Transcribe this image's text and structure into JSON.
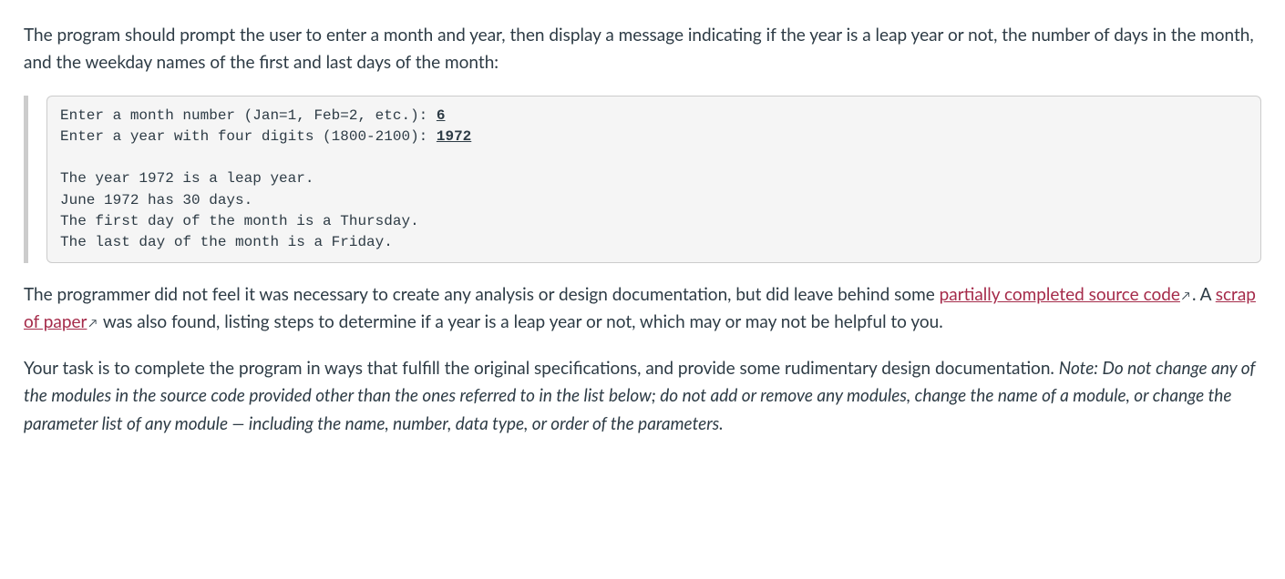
{
  "paragraphs": {
    "intro": "The program should prompt the user to enter a month and year, then display a message indicating if the year is a leap year or not, the number of days in the month, and the weekday names of the first and last days of the month:",
    "p2_part1": "The programmer did not feel it was necessary to create any analysis or design documentation, but did leave behind some ",
    "link1_text": "partially completed source code",
    "p2_part2": ". A ",
    "link2_text": "scrap of paper",
    "p2_part3": " was also found, listing steps to determine if a year is a leap year or not, which may or may not be helpful to you.",
    "p3_plain": "Your task is to complete the program in ways that fulfill the original specifications, and provide some rudimentary design documentation. ",
    "p3_italic": "Note: Do not change any of the modules in the source code provided other than the ones referred to in the list below; do not add or remove any modules, change the name of a module, or change the parameter list of any module — including the name, number, data type, or order of the parameters."
  },
  "code": {
    "line1_prompt": "Enter a month number (Jan=1, Feb=2, etc.): ",
    "line1_input": "6",
    "line2_prompt": "Enter a year with four digits (1800-2100): ",
    "line2_input": "1972",
    "blank": "",
    "line3": "The year 1972 is a leap year.",
    "line4": "June 1972 has 30 days.",
    "line5": "The first day of the month is a Thursday.",
    "line6": "The last day of the month is a Friday."
  },
  "icons": {
    "external": "↗"
  }
}
